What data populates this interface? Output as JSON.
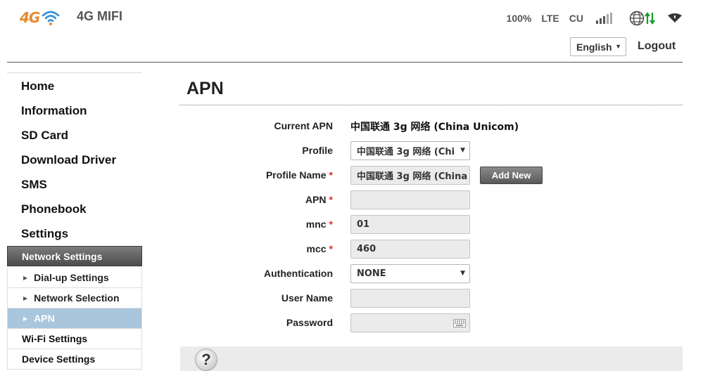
{
  "header": {
    "brand": "4G MIFI",
    "logo_text": "4G",
    "battery": "100%",
    "network_type": "LTE",
    "carrier": "CU",
    "language": "English",
    "logout": "Logout"
  },
  "sidebar": {
    "main_items": [
      "Home",
      "Information",
      "SD Card",
      "Download Driver",
      "SMS",
      "Phonebook",
      "Settings"
    ],
    "network_settings": "Network Settings",
    "sub_items": [
      "Dial-up Settings",
      "Network Selection",
      "APN"
    ],
    "active_sub_item": "APN",
    "sections": [
      "Wi-Fi Settings",
      "Device Settings"
    ]
  },
  "main": {
    "title": "APN",
    "current_apn_label": "Current APN",
    "current_apn_value": "中国联通 3g 网络 (China Unicom)",
    "profile_label": "Profile",
    "profile_value": "中国联通 3g 网络 (Chi",
    "profile_name_label": "Profile Name",
    "profile_name_value": "中国联通 3g 网络 (China",
    "add_new": "Add New",
    "apn_label": "APN",
    "apn_value": "",
    "mnc_label": "mnc",
    "mnc_value": "01",
    "mcc_label": "mcc",
    "mcc_value": "460",
    "auth_label": "Authentication",
    "auth_value": "NONE",
    "username_label": "User Name",
    "username_value": "",
    "password_label": "Password",
    "password_value": "",
    "required_mark": "*",
    "help": "?"
  },
  "colors": {
    "logo_orange": "#e88a2c",
    "wifi_blue": "#2f8fd8",
    "arrow_green": "#1a9a2e",
    "active_sub_bg": "#a9c6dd",
    "required_red": "#d32222"
  },
  "icons": {
    "signal": "signal-bars-icon",
    "globe": "globe-icon",
    "data_arrows": "data-transfer-icon",
    "wifi": "wifi-icon",
    "keyboard": "keyboard-icon",
    "help": "help-icon"
  }
}
